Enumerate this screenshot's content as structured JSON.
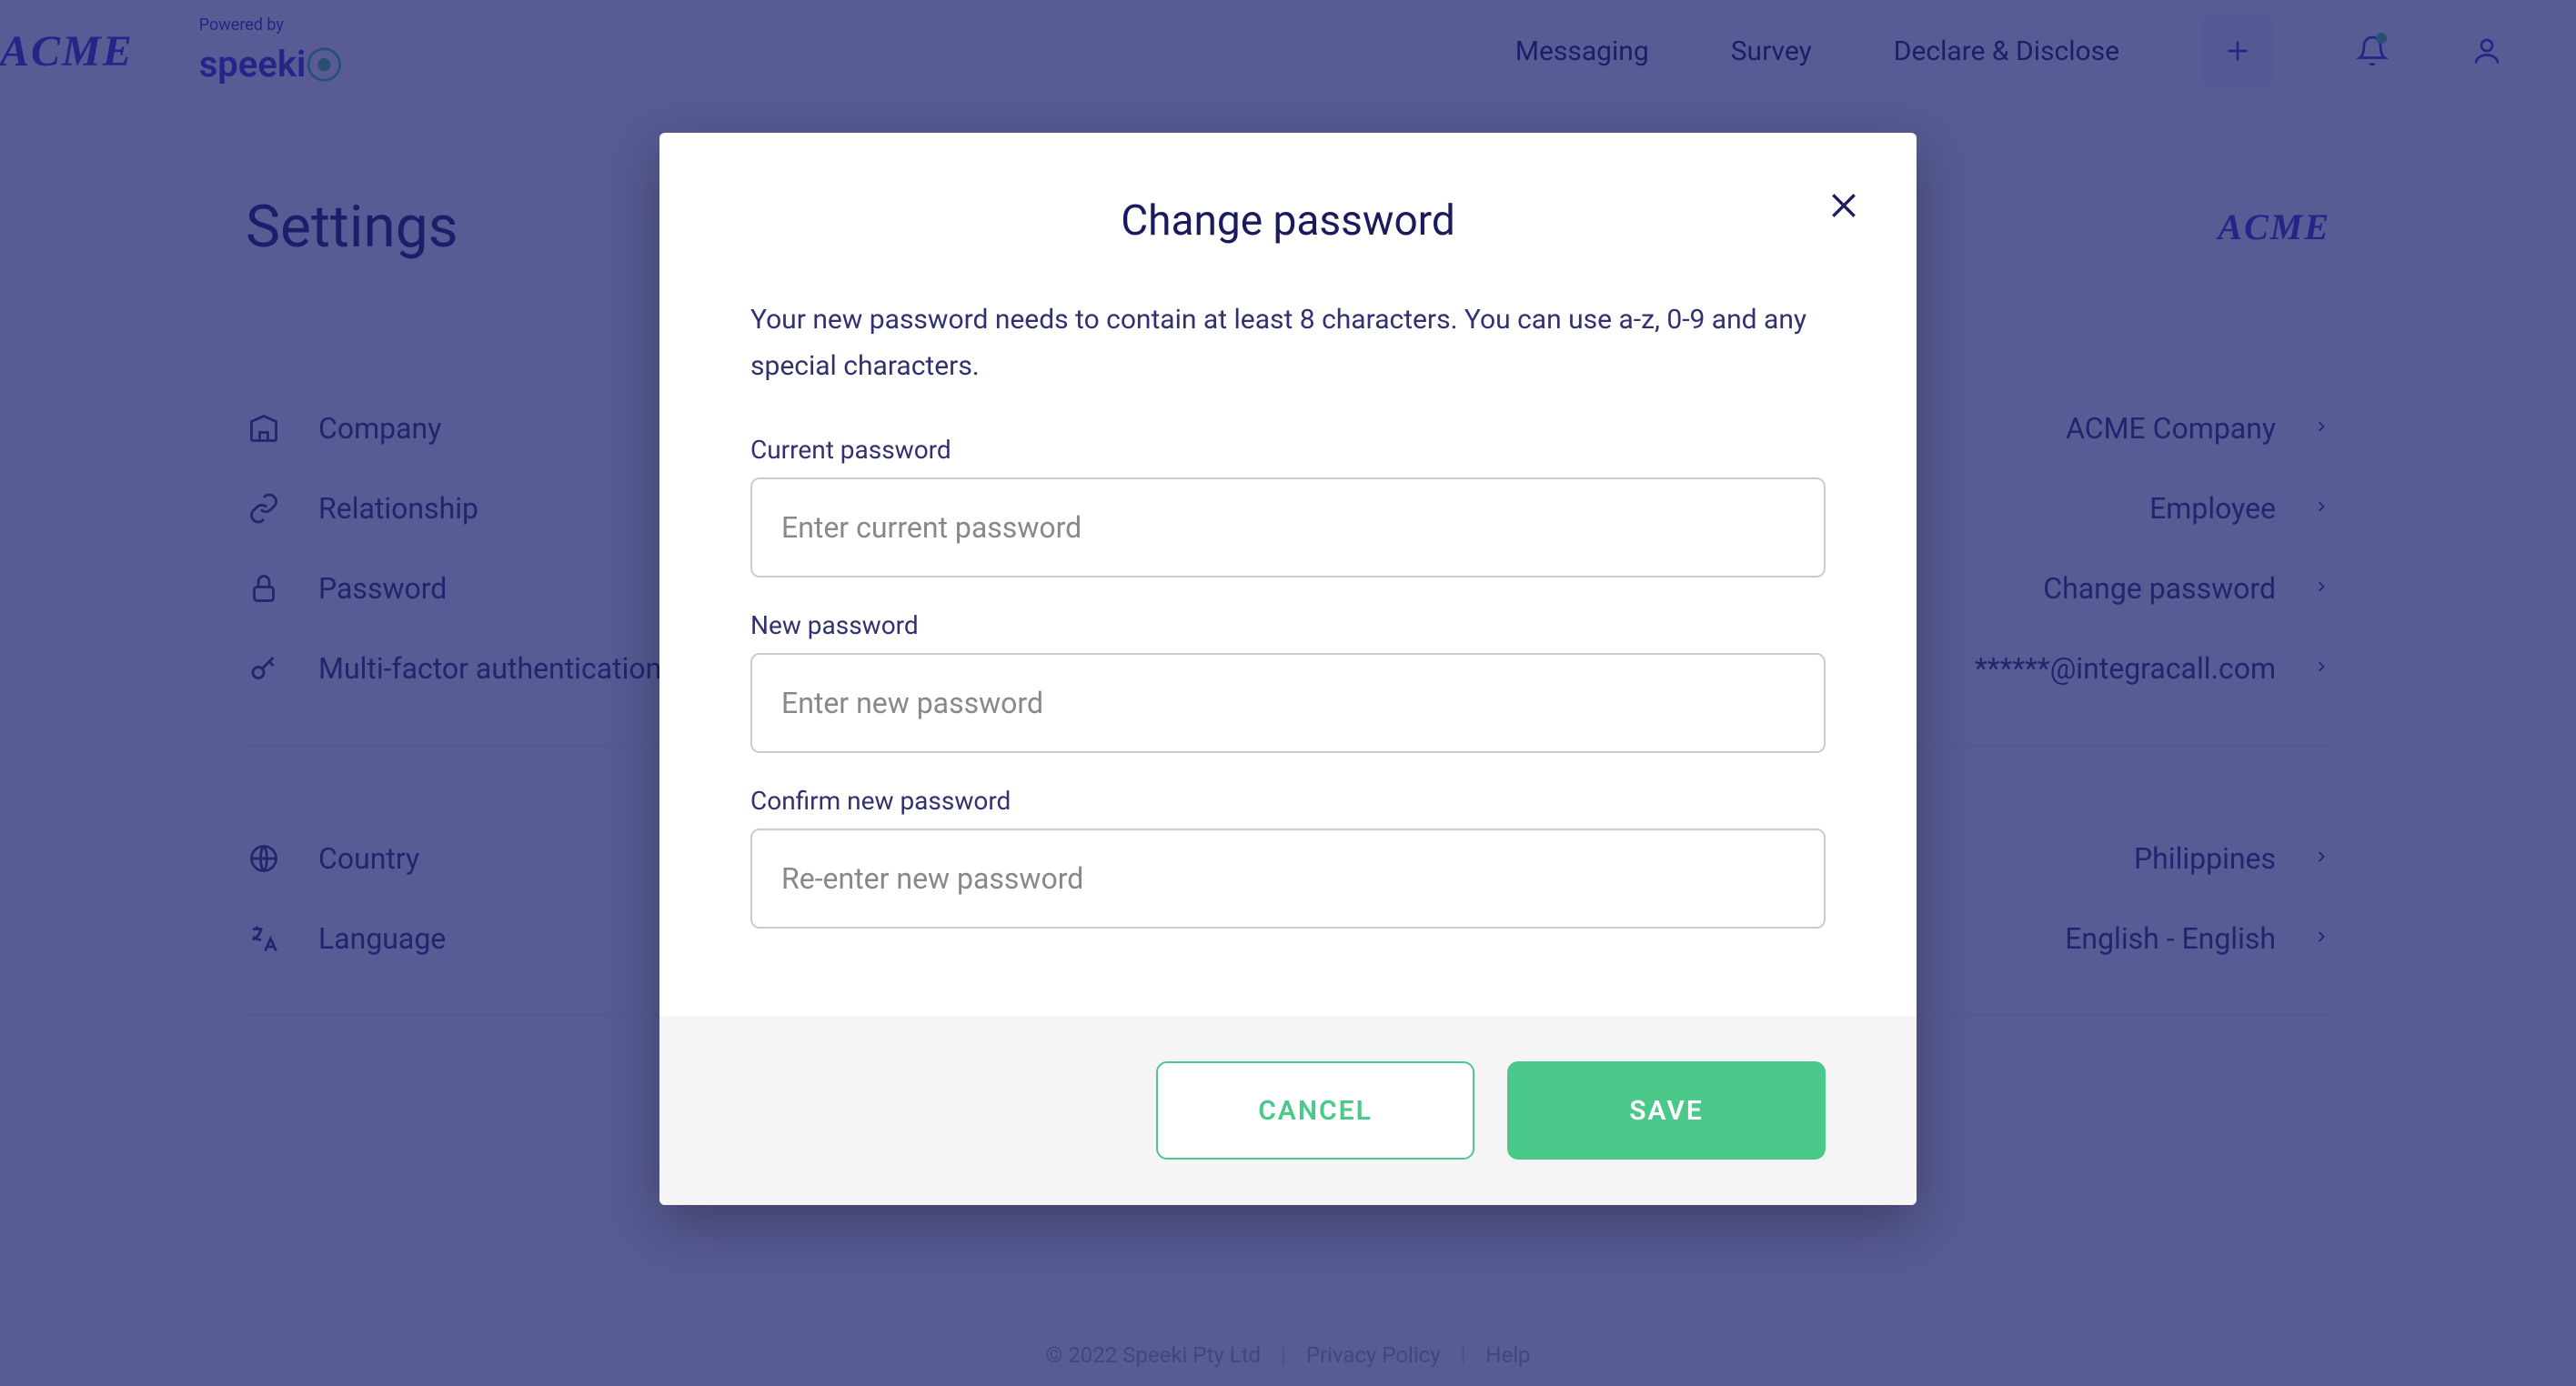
{
  "header": {
    "brand": "ACME",
    "powered_by_label": "Powered by",
    "powered_by_brand": "speeki",
    "nav": {
      "messaging": "Messaging",
      "survey": "Survey",
      "declare": "Declare & Disclose"
    }
  },
  "page": {
    "title": "Settings",
    "brand_small": "ACME"
  },
  "settings": {
    "section1": {
      "company": {
        "label": "Company",
        "value": "ACME Company"
      },
      "relationship": {
        "label": "Relationship",
        "value": "Employee"
      },
      "password": {
        "label": "Password",
        "value": "Change password"
      },
      "mfa": {
        "label": "Multi-factor authentication",
        "value": "******@integracall.com"
      }
    },
    "section2": {
      "country": {
        "label": "Country",
        "value": "Philippines"
      },
      "language": {
        "label": "Language",
        "value": "English - English"
      }
    }
  },
  "modal": {
    "title": "Change password",
    "help": "Your new password needs to contain at least 8 characters. You can use a-z, 0-9 and any special characters.",
    "current": {
      "label": "Current password",
      "placeholder": "Enter current password"
    },
    "new": {
      "label": "New password",
      "placeholder": "Enter new password"
    },
    "confirm": {
      "label": "Confirm new password",
      "placeholder": "Re-enter new password"
    },
    "cancel": "CANCEL",
    "save": "SAVE"
  },
  "footer": {
    "copyright": "© 2022 Speeki Pty Ltd",
    "privacy": "Privacy Policy",
    "help": "Help"
  }
}
